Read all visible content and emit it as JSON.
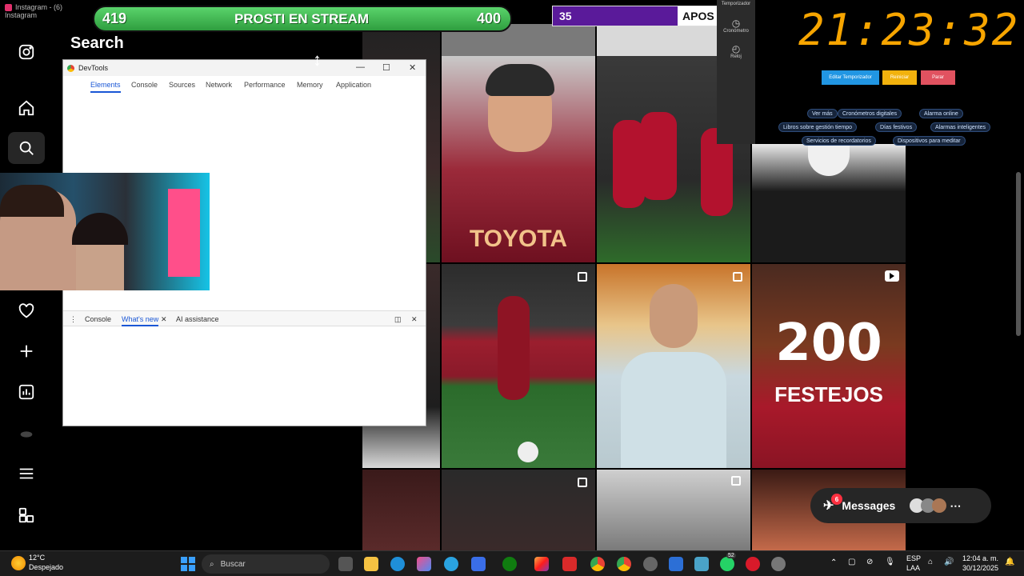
{
  "browser_tab": {
    "title": "Instagram - (6) Instagram"
  },
  "sidebar": {
    "search_title": "Search",
    "items": [
      {
        "name": "instagram-logo-icon"
      },
      {
        "name": "home-icon"
      },
      {
        "name": "search-icon",
        "active": true
      },
      {
        "name": "notifications-heart-icon"
      },
      {
        "name": "create-plus-icon"
      },
      {
        "name": "dashboard-icon"
      },
      {
        "name": "meta-icon"
      },
      {
        "name": "menu-icon"
      },
      {
        "name": "apps-icon"
      }
    ]
  },
  "banner": {
    "left_score": "419",
    "title": "PROSTI EN STREAM",
    "right_score": "400"
  },
  "purple_bar": {
    "count": "35",
    "label": "APOS"
  },
  "timer": {
    "side_title": "Temporizador",
    "side_items": [
      "Cronómetro",
      "Reloj"
    ],
    "clock": "21:23:32",
    "buttons": [
      "Editar Temporizador",
      "Reiniciar",
      "Parar"
    ],
    "chips": [
      "Ver más",
      "Cronómetros digitales",
      "Alarma online",
      "Libros sobre gestión tiempo",
      "Días festivos",
      "Alarmas inteligentes",
      "Servicios de recordatorios",
      "Dispositivos para meditar"
    ],
    "accent": "#f7a500"
  },
  "devtools": {
    "title": "DevTools",
    "tabs": [
      "Elements",
      "Console",
      "Sources",
      "Network",
      "Performance",
      "Memory",
      "Application"
    ],
    "drawer_tabs": [
      "Console",
      "What's new",
      "AI assistance"
    ]
  },
  "grid": {
    "tiles": [
      {
        "text": "TOYOTA"
      },
      {
        "text": "200"
      },
      {
        "text": "FESTEJOS"
      }
    ]
  },
  "messages": {
    "label": "Messages",
    "badge": "6"
  },
  "taskbar": {
    "weather_temp": "12°C",
    "weather_desc": "Despejado",
    "search_placeholder": "Buscar",
    "lang": "ESP",
    "lang_sub": "LAA",
    "time": "12:04 a. m.",
    "date": "30/12/2025",
    "notif_badge": "52"
  }
}
